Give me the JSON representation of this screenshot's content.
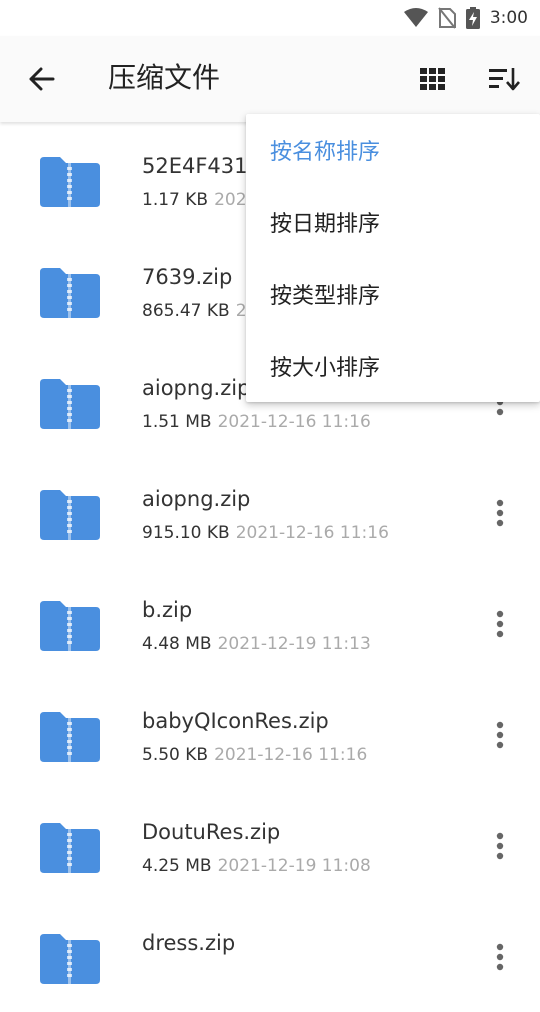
{
  "status_bar": {
    "time": "3:00"
  },
  "app_bar": {
    "title": "压缩文件"
  },
  "files": [
    {
      "name": "52E4F431",
      "size": "1.17 KB",
      "date": "2021"
    },
    {
      "name": "7639.zip",
      "size": "865.47 KB",
      "date": "2"
    },
    {
      "name": "aiopng.zip",
      "size": "1.51 MB",
      "date": "2021-12-16 11:16"
    },
    {
      "name": "aiopng.zip",
      "size": "915.10 KB",
      "date": "2021-12-16 11:16"
    },
    {
      "name": "b.zip",
      "size": "4.48 MB",
      "date": "2021-12-19 11:13"
    },
    {
      "name": "babyQIconRes.zip",
      "size": "5.50 KB",
      "date": "2021-12-16 11:16"
    },
    {
      "name": "DoutuRes.zip",
      "size": "4.25 MB",
      "date": "2021-12-19 11:08"
    },
    {
      "name": "dress.zip",
      "size": "",
      "date": ""
    }
  ],
  "sort_menu": {
    "items": [
      {
        "label": "按名称排序",
        "active": true
      },
      {
        "label": "按日期排序",
        "active": false
      },
      {
        "label": "按类型排序",
        "active": false
      },
      {
        "label": "按大小排序",
        "active": false
      }
    ]
  },
  "colors": {
    "accent": "#4a8fdf",
    "folder": "#4a8fdf",
    "meta_date": "#aaaaaa"
  },
  "icons": [
    "wifi-icon",
    "no-sim-icon",
    "battery-charging-icon",
    "back-arrow-icon",
    "grid-view-icon",
    "sort-icon",
    "zip-folder-icon",
    "more-vert-icon"
  ]
}
